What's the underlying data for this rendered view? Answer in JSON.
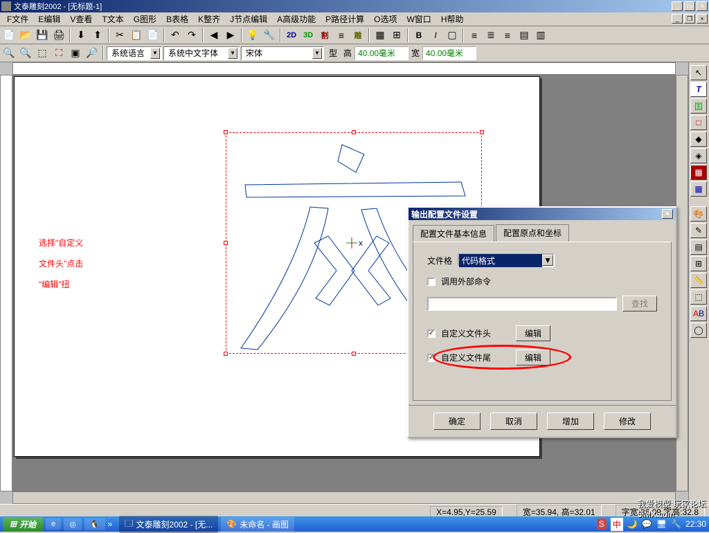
{
  "titlebar": {
    "title": "文泰雕刻2002 - [无标题-1]"
  },
  "menu": [
    "F文件",
    "E编辑",
    "V查看",
    "T文本",
    "G图形",
    "B表格",
    "K整齐",
    "J节点编辑",
    "A高级功能",
    "P路径计算",
    "O选项",
    "W窗口",
    "H帮助"
  ],
  "toolbar2": {
    "mode2d": "2D",
    "mode3d": "3D",
    "modeCut": "割",
    "modeEng": "雕"
  },
  "toolbar3": {
    "langLabel": "系统语言",
    "fontLabel": "系统中文字体",
    "fontName": "宋体",
    "btnType": "型",
    "heightLabel": "高",
    "heightVal": "40.00毫米",
    "widthLabel": "宽",
    "widthVal": "40.00毫米"
  },
  "annotation": [
    "选择\"自定义",
    "文件头\"点击",
    "\"编辑\"扭"
  ],
  "dialog": {
    "title": "输出配置文件设置",
    "tabs": [
      "配置文件基本信息",
      "配置原点和坐标"
    ],
    "fileFormatLabel": "文件格",
    "fileFormatValue": "代码格式",
    "callExternal": "调用外部命令",
    "findBtn": "查找",
    "customHeader": "自定义文件头",
    "editBtn": "编辑",
    "customFooter": "自定义文件尾",
    "ok": "确定",
    "cancel": "取消",
    "add": "增加",
    "modify": "修改"
  },
  "status": {
    "xy": "X=4.95,Y=25.59",
    "dim": "宽=35.94, 高=32.01",
    "charDim": "字宽:36.09,字高:32.8"
  },
  "taskbar": {
    "start": "开始",
    "tasks": [
      "文泰雕刻2002 - [无...",
      "未命名 - 画图"
    ],
    "time": "22:30",
    "watermark": "我爱模型 玩家论坛",
    "watermark2": "5iMX.com",
    "imeText": "中"
  }
}
